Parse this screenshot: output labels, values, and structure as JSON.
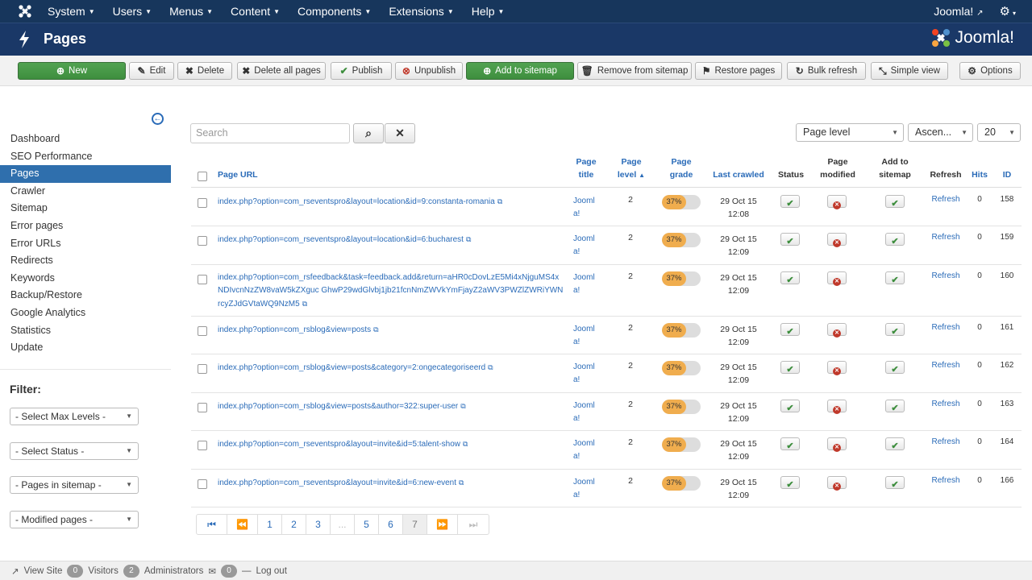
{
  "topbar": {
    "menus": [
      "System",
      "Users",
      "Menus",
      "Content",
      "Components",
      "Extensions",
      "Help"
    ],
    "site_link": "Joomla!",
    "icons": {
      "brand": "joomla-icon",
      "settings": "gear-icon",
      "external": "external-link-icon"
    }
  },
  "header": {
    "title": "Pages",
    "logo_text": "Joomla!",
    "icon": "lightning-icon"
  },
  "toolbar": {
    "buttons": [
      {
        "label": "New",
        "icon": "plus-circle-icon",
        "style": "green"
      },
      {
        "label": "Edit",
        "icon": "edit-icon"
      },
      {
        "label": "Delete",
        "icon": "x-icon"
      },
      {
        "label": "Delete all pages",
        "icon": "x-icon"
      },
      {
        "label": "Publish",
        "icon": "check-icon"
      },
      {
        "label": "Unpublish",
        "icon": "unpublish-icon"
      },
      {
        "label": "Add to sitemap",
        "icon": "plus-circle-icon",
        "style": "green"
      },
      {
        "label": "Remove from sitemap",
        "icon": "trash-icon"
      },
      {
        "label": "Restore pages",
        "icon": "flag-icon"
      },
      {
        "label": "Bulk refresh",
        "icon": "refresh-icon"
      },
      {
        "label": "Simple view",
        "icon": "collapse-icon"
      },
      {
        "label": "Options",
        "icon": "gear-icon"
      }
    ]
  },
  "sidebar": {
    "items": [
      "Dashboard",
      "SEO Performance",
      "Pages",
      "Crawler",
      "Sitemap",
      "Error pages",
      "Error URLs",
      "Redirects",
      "Keywords",
      "Backup/Restore",
      "Google Analytics",
      "Statistics",
      "Update"
    ],
    "active": "Pages",
    "filter_title": "Filter:",
    "filters": [
      "- Select Max Levels -",
      "- Select Status -",
      "- Pages in sitemap -",
      "- Modified pages -"
    ]
  },
  "search": {
    "placeholder": "Search"
  },
  "list_controls": {
    "sort_field": "Page level",
    "direction": "Ascen...",
    "limit": "20"
  },
  "table": {
    "columns": [
      "Page URL",
      "Page title",
      "Page level",
      "Page grade",
      "Last crawled",
      "Status",
      "Page modified",
      "Add to sitemap",
      "Refresh",
      "Hits",
      "ID"
    ],
    "rows": [
      {
        "url": "index.php?option=com_rseventspro&layout=location&id=9:constanta-romania",
        "title": "Joomla!",
        "level": "2",
        "grade": "37%",
        "crawled": "29 Oct 15 12:08",
        "status": "ok",
        "modified": "no",
        "sitemap": "ok",
        "refresh": "Refresh",
        "hits": "0",
        "id": "158"
      },
      {
        "url": "index.php?option=com_rseventspro&layout=location&id=6:bucharest",
        "title": "Joomla!",
        "level": "2",
        "grade": "37%",
        "crawled": "29 Oct 15 12:09",
        "status": "ok",
        "modified": "no",
        "sitemap": "ok",
        "refresh": "Refresh",
        "hits": "0",
        "id": "159"
      },
      {
        "url": "index.php?option=com_rsfeedback&task=feedback.add&return=aHR0cDovLzE5Mi4xNjguMS4xNDIvcnNzZW8vaW5kZXguc GhwP29wdGlvbj1jb21fcnNmZWVkYmFjayZ2aWV3PWZlZWRiYWNrcyZJdGVtaWQ9NzM5",
        "title": "Joomla!",
        "level": "2",
        "grade": "37%",
        "crawled": "29 Oct 15 12:09",
        "status": "ok",
        "modified": "no",
        "sitemap": "ok",
        "refresh": "Refresh",
        "hits": "0",
        "id": "160"
      },
      {
        "url": "index.php?option=com_rsblog&view=posts",
        "title": "Joomla!",
        "level": "2",
        "grade": "37%",
        "crawled": "29 Oct 15 12:09",
        "status": "ok",
        "modified": "no",
        "sitemap": "ok",
        "refresh": "Refresh",
        "hits": "0",
        "id": "161"
      },
      {
        "url": "index.php?option=com_rsblog&view=posts&category=2:ongecategoriseerd",
        "title": "Joomla!",
        "level": "2",
        "grade": "37%",
        "crawled": "29 Oct 15 12:09",
        "status": "ok",
        "modified": "no",
        "sitemap": "ok",
        "refresh": "Refresh",
        "hits": "0",
        "id": "162"
      },
      {
        "url": "index.php?option=com_rsblog&view=posts&author=322:super-user",
        "title": "Joomla!",
        "level": "2",
        "grade": "37%",
        "crawled": "29 Oct 15 12:09",
        "status": "ok",
        "modified": "no",
        "sitemap": "ok",
        "refresh": "Refresh",
        "hits": "0",
        "id": "163"
      },
      {
        "url": "index.php?option=com_rseventspro&layout=invite&id=5:talent-show",
        "title": "Joomla!",
        "level": "2",
        "grade": "37%",
        "crawled": "29 Oct 15 12:09",
        "status": "ok",
        "modified": "no",
        "sitemap": "ok",
        "refresh": "Refresh",
        "hits": "0",
        "id": "164"
      },
      {
        "url": "index.php?option=com_rseventspro&layout=invite&id=6:new-event",
        "title": "Joomla!",
        "level": "2",
        "grade": "37%",
        "crawled": "29 Oct 15 12:09",
        "status": "ok",
        "modified": "no",
        "sitemap": "ok",
        "refresh": "Refresh",
        "hits": "0",
        "id": "166"
      }
    ]
  },
  "pagination": {
    "pages": [
      "1",
      "2",
      "3",
      "...",
      "5",
      "6",
      "7"
    ],
    "current": "7"
  },
  "statusbar": {
    "view_site": "View Site",
    "visitors_count": "0",
    "visitors": "Visitors",
    "admins_count": "2",
    "admins": "Administrators",
    "messages_count": "0",
    "logout": "Log out"
  }
}
